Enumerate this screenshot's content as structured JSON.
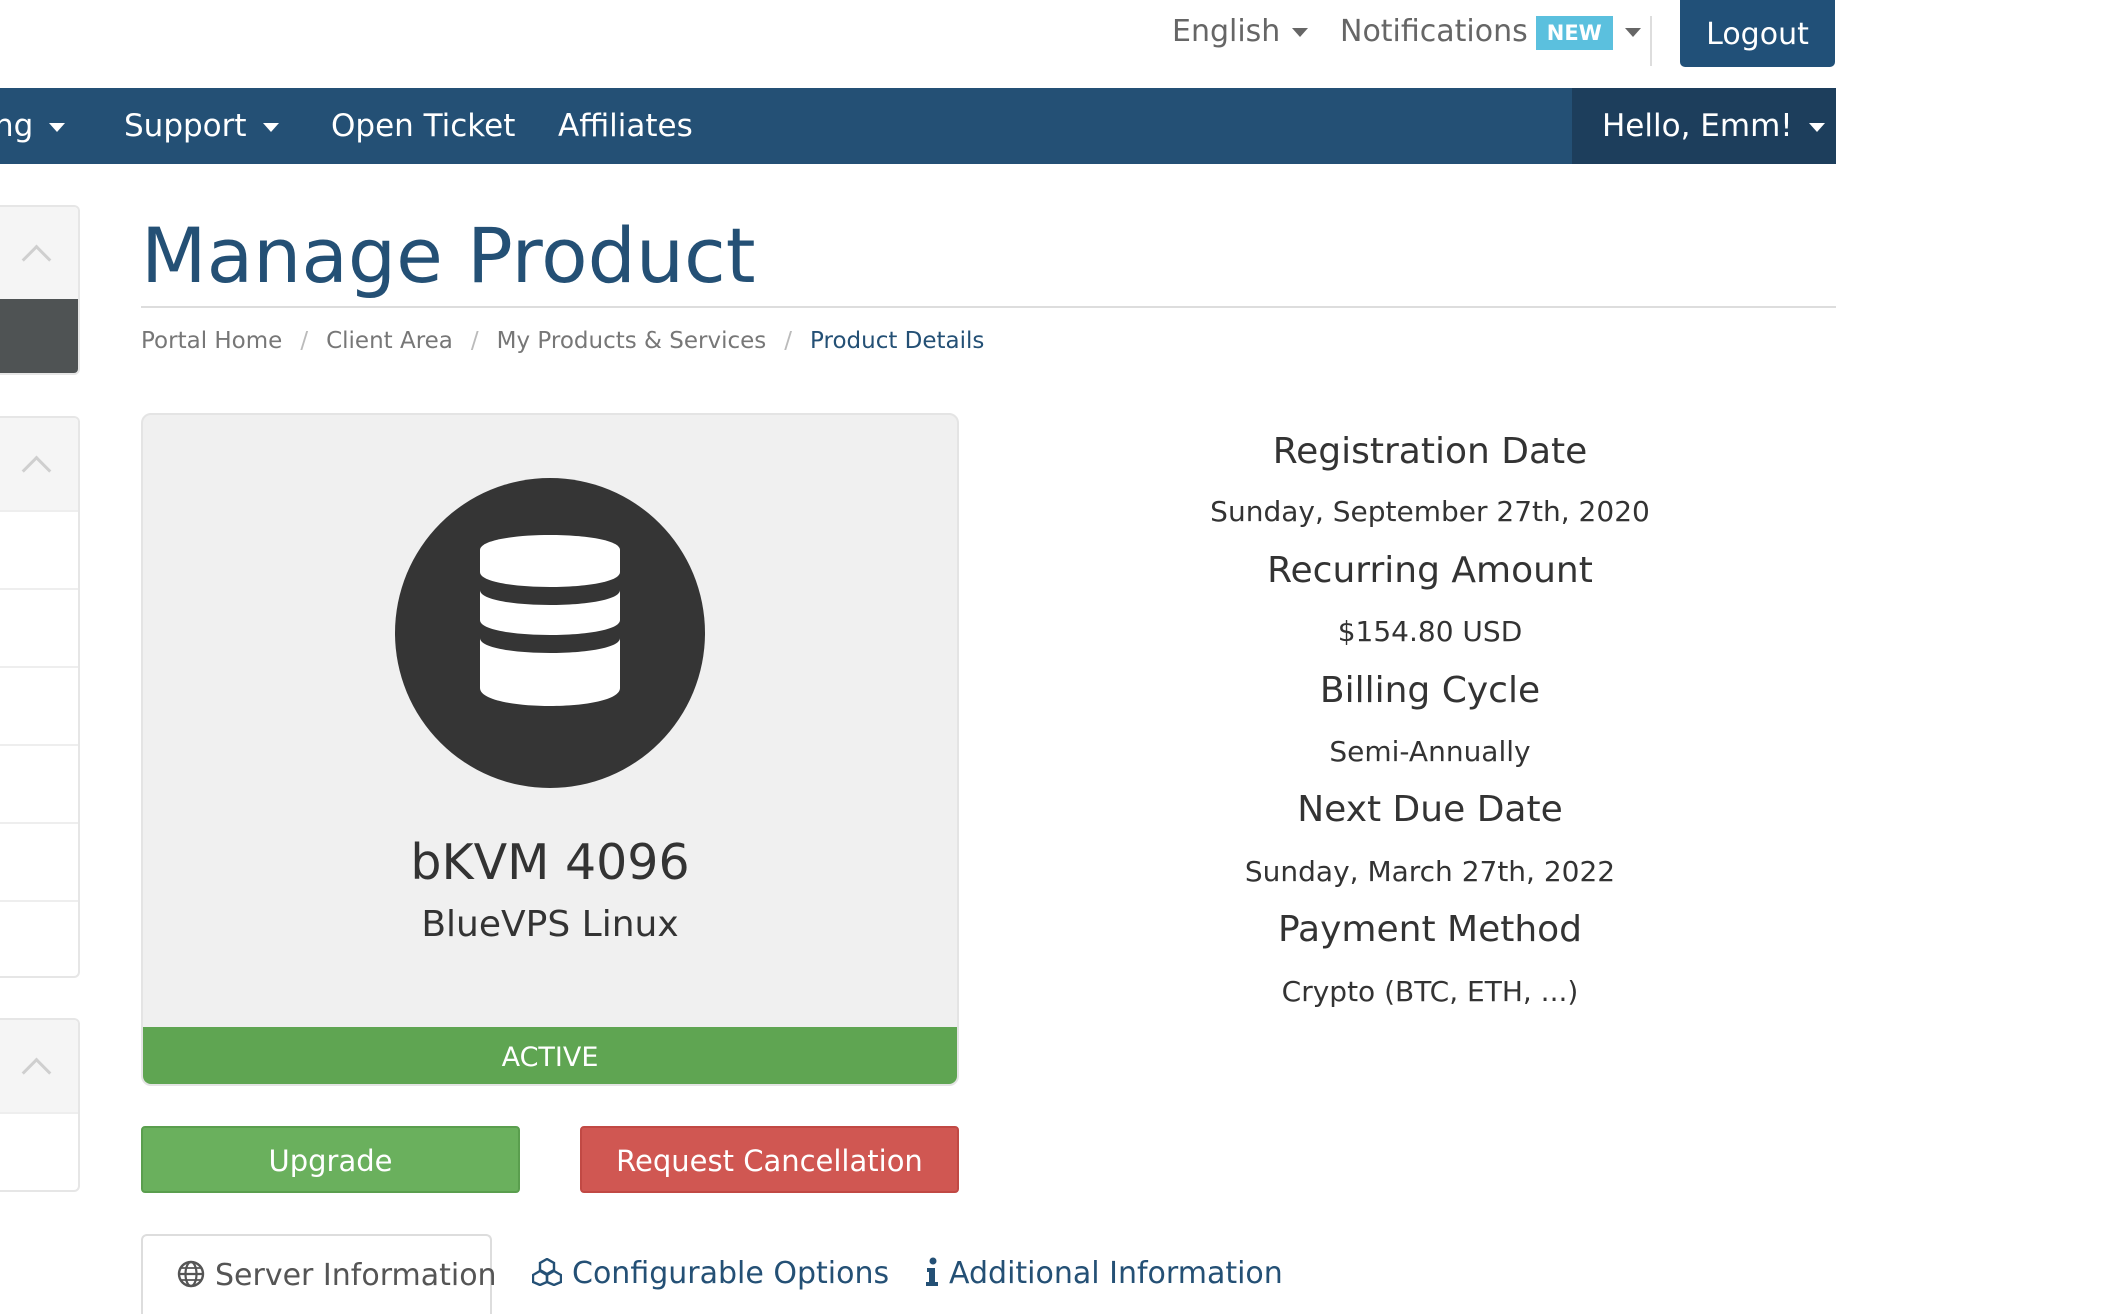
{
  "topbar": {
    "language": "English",
    "notifications": "Notifications",
    "notifications_badge": "NEW",
    "logout": "Logout"
  },
  "nav": {
    "items": [
      {
        "label": "ng",
        "has_dropdown": true
      },
      {
        "label": "Support",
        "has_dropdown": true
      },
      {
        "label": "Open Ticket",
        "has_dropdown": false
      },
      {
        "label": "Affiliates",
        "has_dropdown": false
      }
    ],
    "user_greeting": "Hello, Emm!"
  },
  "page": {
    "title": "Manage Product",
    "breadcrumb": [
      "Portal Home",
      "Client Area",
      "My Products & Services",
      "Product Details"
    ]
  },
  "product": {
    "icon": "database-icon",
    "name": "bKVM 4096",
    "group": "BlueVPS Linux",
    "status": "ACTIVE"
  },
  "actions": {
    "upgrade": "Upgrade",
    "cancel": "Request Cancellation"
  },
  "details": [
    {
      "label": "Registration Date",
      "value": "Sunday, September 27th, 2020"
    },
    {
      "label": "Recurring Amount",
      "value": "$154.80 USD"
    },
    {
      "label": "Billing Cycle",
      "value": "Semi-Annually"
    },
    {
      "label": "Next Due Date",
      "value": "Sunday, March 27th, 2022"
    },
    {
      "label": "Payment Method",
      "value": "Crypto (BTC, ETH, ...)"
    }
  ],
  "tabs": [
    {
      "label": "Server Information",
      "icon": "globe-icon",
      "active": true
    },
    {
      "label": "Configurable Options",
      "icon": "cubes-icon",
      "active": false
    },
    {
      "label": "Additional Information",
      "icon": "info-icon",
      "active": false
    }
  ],
  "colors": {
    "brand": "#245075",
    "active_status": "#5fa552",
    "upgrade": "#6ab05d",
    "cancel": "#d05752",
    "badge": "#5bc0de"
  }
}
